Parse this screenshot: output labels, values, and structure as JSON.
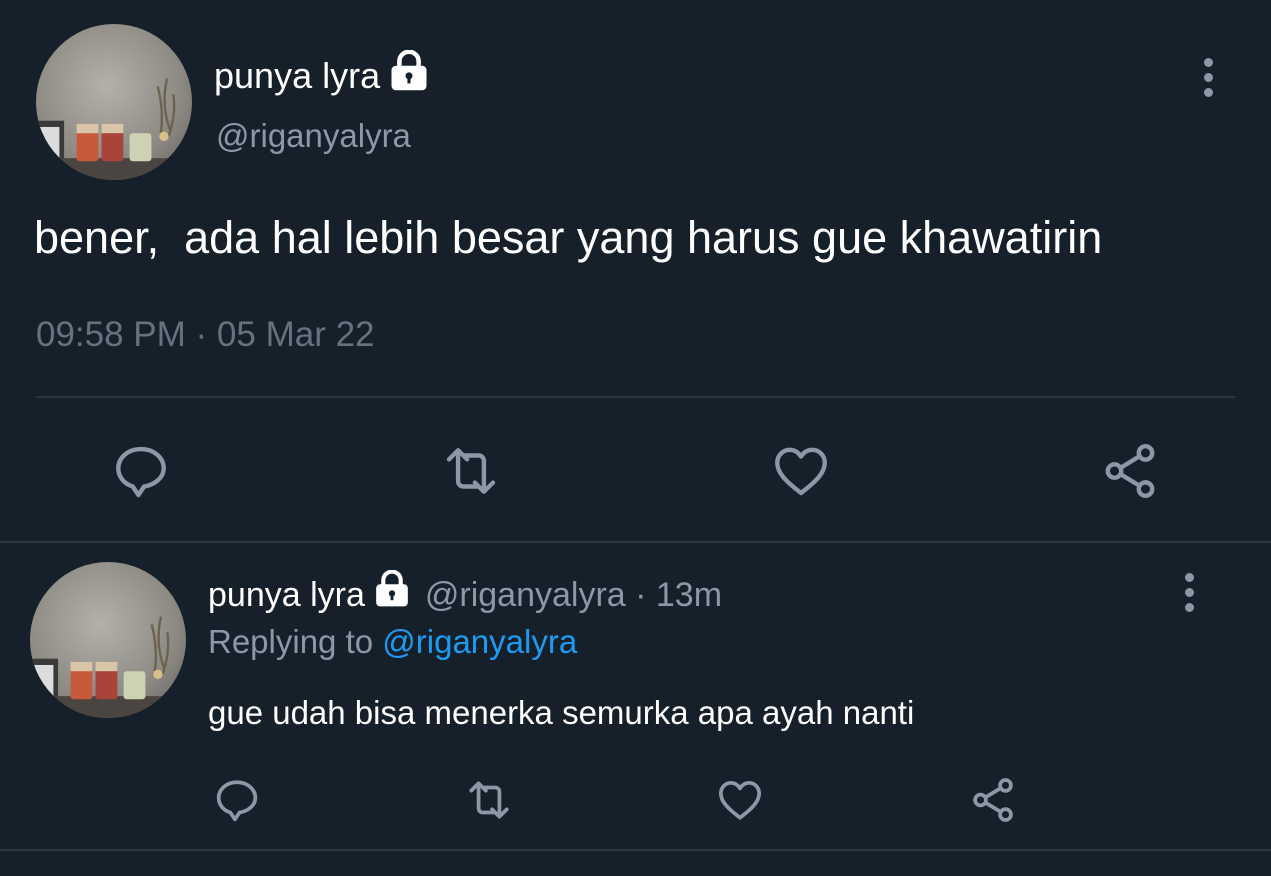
{
  "colors": {
    "background": "#15202b",
    "text_primary": "#ffffff",
    "text_secondary": "#8b98a5",
    "text_muted": "#65737e",
    "link": "#1d9bf0",
    "divider": "#2a3642",
    "icon": "#8b98a5"
  },
  "main_tweet": {
    "display_name": "punya lyra",
    "handle": "@riganyalyra",
    "text": "bener,  ada hal lebih besar yang harus gue khawatirin",
    "timestamp": "09:58 PM · 05 Mar 22",
    "icons": {
      "protected": "lock-icon",
      "more": "more-vertical-icon",
      "reply": "reply-icon",
      "retweet": "retweet-icon",
      "like": "heart-icon",
      "share": "share-icon"
    }
  },
  "reply_tweet": {
    "display_name": "punya lyra",
    "handle_time": "@riganyalyra · 13m",
    "replying_prefix": "Replying to",
    "replying_to": "@riganyalyra",
    "text": "gue udah bisa menerka semurka apa ayah nanti",
    "icons": {
      "protected": "lock-icon",
      "more": "more-vertical-icon",
      "reply": "reply-icon",
      "retweet": "retweet-icon",
      "like": "heart-icon",
      "share": "share-icon"
    }
  }
}
